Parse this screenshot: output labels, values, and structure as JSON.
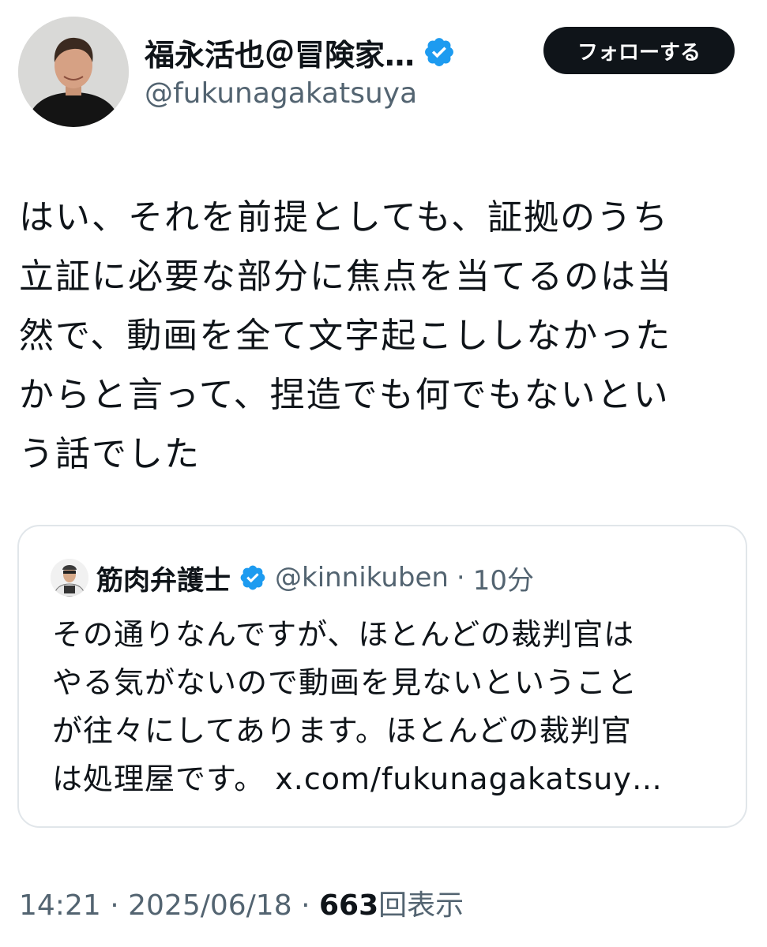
{
  "author": {
    "name": "福永活也＠冒険家…",
    "handle": "@fukunagakatsuya",
    "avatar_icon": "user-avatar-icon",
    "verified_icon": "verified-badge-icon",
    "verified_color": "#1d9bf0"
  },
  "follow_button": {
    "label": "フォローする",
    "background": "#0f1419"
  },
  "tweet": {
    "lines": [
      "はい、それを前提としても、証拠のうち",
      "立証に必要な部分に焦点を当てるのは当",
      "然で、動画を全て文字起こししなかった",
      "からと言って、捏造でも何でもないとい",
      "う話でした"
    ]
  },
  "quote": {
    "name": "筋肉弁護士",
    "handle": "@kinnikuben",
    "separator": "·",
    "time": "10分",
    "lines": [
      "その通りなんですが、ほとんどの裁判官は",
      "やる気がないので動画を見ないということ",
      "が往々にしてあります。ほとんどの裁判官"
    ],
    "last_line_text": "は処理屋です。",
    "link": "x.com/fukunagakatsuy…"
  },
  "meta": {
    "time": "14:21",
    "separator": "·",
    "date": "2025/06/18",
    "views_count": "663",
    "views_label": "回表示"
  }
}
